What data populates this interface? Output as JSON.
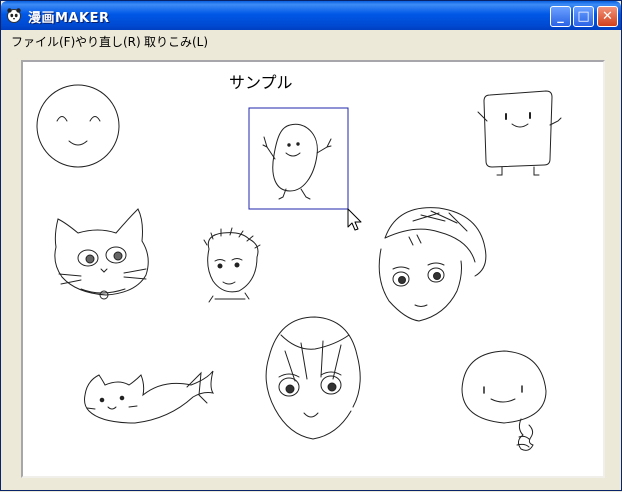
{
  "window": {
    "title": "漫画MAKER",
    "buttons": {
      "minimize": "_",
      "maximize": "□",
      "close": "✕"
    }
  },
  "menu": {
    "items": [
      {
        "label": "ファイル(F)"
      },
      {
        "label": "やり直し(R)"
      },
      {
        "label": "取りこみ(L)"
      }
    ]
  },
  "canvas": {
    "label": "サンプル",
    "selection_color": "#1f24a8"
  },
  "icons": {
    "app": "panda-face-icon",
    "cursor": "mouse-pointer-icon"
  }
}
